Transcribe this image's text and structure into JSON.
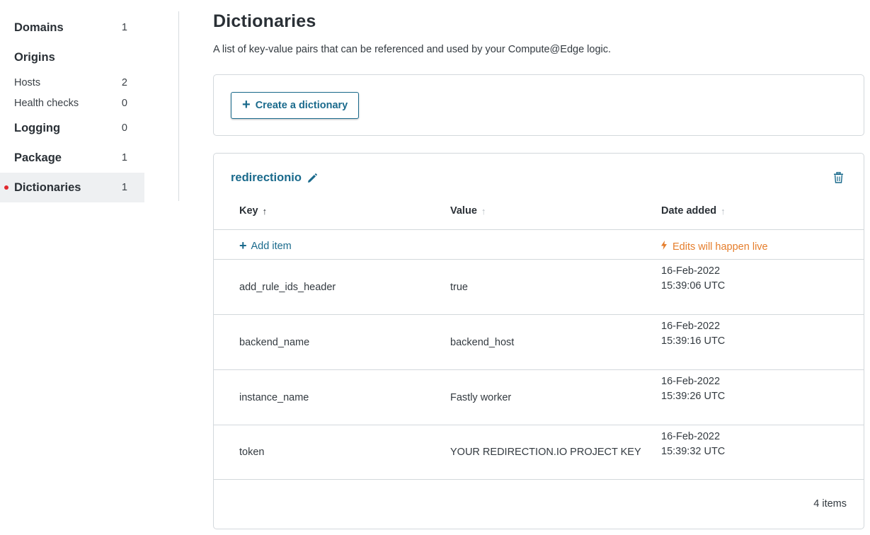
{
  "sidebar": {
    "items": [
      {
        "label": "Domains",
        "count": "1"
      },
      {
        "label": "Origins"
      },
      {
        "label": "Hosts",
        "count": "2"
      },
      {
        "label": "Health checks",
        "count": "0"
      },
      {
        "label": "Logging",
        "count": "0"
      },
      {
        "label": "Package",
        "count": "1"
      },
      {
        "label": "Dictionaries",
        "count": "1",
        "active": true
      }
    ]
  },
  "page": {
    "title": "Dictionaries",
    "description": "A list of key-value pairs that can be referenced and used by your Compute@Edge logic."
  },
  "create_button": {
    "label": "Create a dictionary",
    "icon": "plus-icon"
  },
  "dictionary": {
    "name": "redirectionio",
    "columns": {
      "key": "Key",
      "value": "Value",
      "date": "Date added"
    },
    "add_item_label": "Add item",
    "live_note": "Edits will happen live",
    "rows": [
      {
        "key": "add_rule_ids_header",
        "value": "true",
        "date": "16-Feb-2022",
        "time": "15:39:06 UTC"
      },
      {
        "key": "backend_name",
        "value": "backend_host",
        "date": "16-Feb-2022",
        "time": "15:39:16 UTC"
      },
      {
        "key": "instance_name",
        "value": "Fastly worker",
        "date": "16-Feb-2022",
        "time": "15:39:26 UTC"
      },
      {
        "key": "token",
        "value": "YOUR REDIRECTION.IO PROJECT KEY",
        "date": "16-Feb-2022",
        "time": "15:39:32 UTC"
      }
    ],
    "items_count": "4 items"
  },
  "colors": {
    "link": "#1a6a8c",
    "warning": "#e57d2b",
    "active_dot": "#e0282e",
    "active_bg": "#eef0f2"
  }
}
